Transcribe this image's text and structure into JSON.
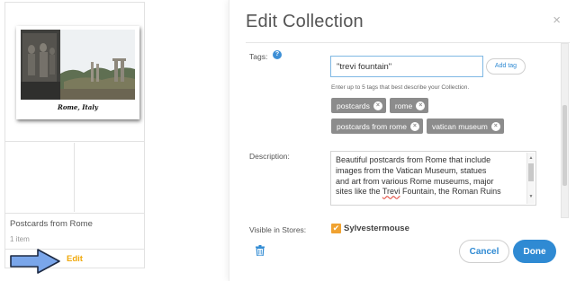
{
  "collection_card": {
    "cover_caption": "Rome, Italy",
    "title": "Postcards from Rome",
    "item_count": "1 item",
    "edit_label": "Edit"
  },
  "modal": {
    "title": "Edit Collection",
    "close_glyph": "×",
    "tags": {
      "label": "Tags:",
      "help_glyph": "?",
      "input_value": "\"trevi fountain\"",
      "add_button_label": "Add tag",
      "hint": "Enter up to 5 tags that best describe your Collection.",
      "chips_row1": [
        "postcards",
        "rome"
      ],
      "chips_row2": [
        "postcards from rome",
        "vatican museum"
      ],
      "remove_glyph": "×"
    },
    "description": {
      "label": "Description:",
      "line1": "Beautiful postcards from Rome that include",
      "line2": "images from the Vatican Museum, statues",
      "line3": "and art from various Rome museums, major",
      "line4_before": "sites like the ",
      "line4_misspelled": "Trevi",
      "line4_after": " Fountain, the Roman Ruins"
    },
    "visible_in_stores": {
      "label": "Visible in Stores:",
      "check_glyph": "✔",
      "store_name": "Sylvestermouse"
    },
    "buttons": {
      "cancel_label": "Cancel",
      "done_label": "Done"
    }
  },
  "colors": {
    "accent_blue": "#2f8ad3",
    "edit_orange": "#f0a80a",
    "checkbox_orange": "#f0a230",
    "chip_gray": "#8c8c8c",
    "pointer_arrow_blue": "#7aa6ea"
  }
}
